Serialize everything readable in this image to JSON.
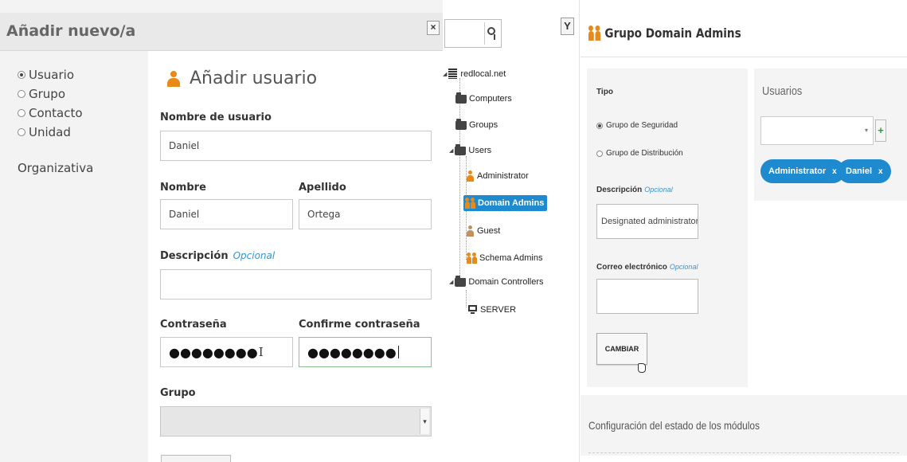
{
  "dialog": {
    "title": "Añadir nuevo/a",
    "close_symbol": "×",
    "types": [
      {
        "label": "Usuario",
        "selected": true
      },
      {
        "label": "Grupo",
        "selected": false
      },
      {
        "label": "Contacto",
        "selected": false
      },
      {
        "label": "Unidad",
        "selected": false
      }
    ],
    "type_last_line": "Organizativa",
    "form": {
      "heading": "Añadir usuario",
      "heading_icon": "user-icon",
      "username_label": "Nombre de usuario",
      "username_value": "Daniel",
      "firstname_label": "Nombre",
      "firstname_value": "Daniel",
      "lastname_label": "Apellido",
      "lastname_value": "Ortega",
      "description_label": "Descripción",
      "optional_label": "Opcional",
      "description_value": "",
      "password_label": "Contraseña",
      "password_value": "●●●●●●●●",
      "confirm_label": "Confirme contraseña",
      "confirm_value": "●●●●●●●●",
      "group_label": "Grupo",
      "group_value": ""
    }
  },
  "tree": {
    "search_value": "",
    "filter_icon": "filter-icon",
    "root": "redlocal.net",
    "nodes": {
      "computers": "Computers",
      "groups": "Groups",
      "users": "Users",
      "administrator": "Administrator",
      "domain_admins": "Domain Admins",
      "guest": "Guest",
      "schema_admins": "Schema Admins",
      "domain_controllers": "Domain Controllers",
      "server": "SERVER"
    },
    "selected": "Domain Admins"
  },
  "group": {
    "title": "Grupo Domain Admins",
    "type_label": "Tipo",
    "type_security": "Grupo de Seguridad",
    "type_distribution": "Grupo de Distribución",
    "selected_type": "Grupo de Seguridad",
    "description_label": "Descripción",
    "optional_label": "Opcional",
    "description_value": "Designated administrators o",
    "email_label": "Correo electrónico",
    "email_value": "",
    "change_button": "CAMBIAR",
    "users_title": "Usuarios",
    "users_select_value": "",
    "add_symbol": "+",
    "members": [
      "Administrator",
      "Daniel"
    ],
    "remove_symbol": "x",
    "modules_title": "Configuración del estado de los módulos"
  },
  "colors": {
    "accent_blue": "#1e8bd0",
    "user_orange": "#e88a1a",
    "optional_blue": "#3a93d1",
    "add_green": "#2a9d3a"
  }
}
